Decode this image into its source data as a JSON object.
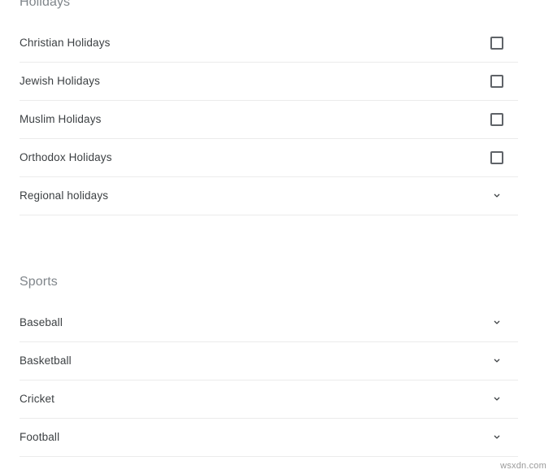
{
  "colors": {
    "background": "#ffffff",
    "section_title": "#80868b",
    "row_label": "#3c4043",
    "divider": "#ebebeb",
    "checkbox_border": "#5f6368",
    "chevron": "#3c4043",
    "watermark": "#9a9a9a"
  },
  "sections": [
    {
      "title": "Holidays",
      "rows": [
        {
          "label": "Christian Holidays",
          "control": "checkbox",
          "checked": false
        },
        {
          "label": "Jewish Holidays",
          "control": "checkbox",
          "checked": false
        },
        {
          "label": "Muslim Holidays",
          "control": "checkbox",
          "checked": false
        },
        {
          "label": "Orthodox Holidays",
          "control": "checkbox",
          "checked": false
        },
        {
          "label": "Regional holidays",
          "control": "chevron-down",
          "checked": false
        }
      ]
    },
    {
      "title": "Sports",
      "rows": [
        {
          "label": "Baseball",
          "control": "chevron-down",
          "checked": false
        },
        {
          "label": "Basketball",
          "control": "chevron-down",
          "checked": false
        },
        {
          "label": "Cricket",
          "control": "chevron-down",
          "checked": false
        },
        {
          "label": "Football",
          "control": "chevron-down",
          "checked": false
        }
      ]
    }
  ],
  "watermark": "wsxdn.com"
}
